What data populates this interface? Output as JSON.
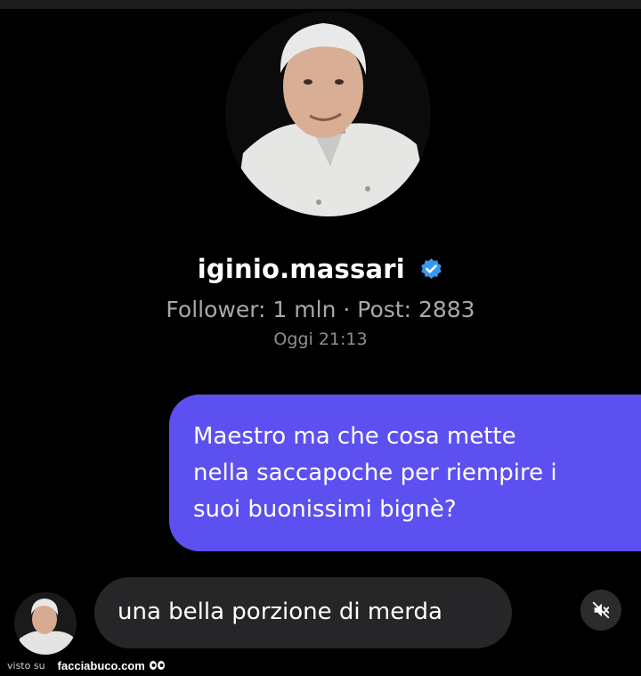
{
  "profile": {
    "avatar_icon": "profile-photo",
    "username": "iginio.massari",
    "verified_icon": "verified-badge-icon",
    "verified_color": "#3897f0",
    "stats": "Follower: 1 mln · Post: 2883"
  },
  "conversation": {
    "timestamp": "Oggi 21:13",
    "sent_message": {
      "lines": [
        "Maestro ma che cosa mette",
        "nella saccapoche per riempire i",
        "suoi buonissimi bignè?"
      ],
      "color": "#5d50f0"
    },
    "received_message": {
      "text": "una bella porzione di merda",
      "color": "#262628"
    },
    "mute_icon": "speaker-muted-icon"
  },
  "footer": {
    "visto": "visto su",
    "brand": "facciabuco.com",
    "eyes_icon": "eyes-icon"
  }
}
